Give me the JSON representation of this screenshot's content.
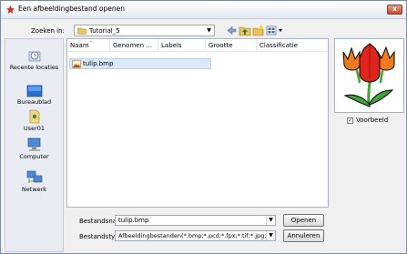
{
  "window": {
    "title": "Een afbeeldingbestand openen",
    "close_glyph": "x"
  },
  "toolbar": {
    "lookin_label": "Zoeken in:",
    "lookin_value": "Tutorial_5",
    "icons": [
      "back-icon",
      "up-folder-icon",
      "new-folder-icon",
      "view-menu-icon"
    ]
  },
  "places": [
    {
      "label": "Recente locaties",
      "icon": "recent-places-icon"
    },
    {
      "label": "Bureaublad",
      "icon": "desktop-icon"
    },
    {
      "label": "User01",
      "icon": "user-folder-icon"
    },
    {
      "label": "Computer",
      "icon": "computer-icon"
    },
    {
      "label": "Netwerk",
      "icon": "network-icon"
    }
  ],
  "filelist": {
    "columns": [
      "Naam",
      "Genomen ...",
      "Labels",
      "Grootte",
      "Classificatie"
    ],
    "files": [
      {
        "name": "tulip.bmp",
        "selected": true
      }
    ]
  },
  "preview": {
    "checkbox_label": "Voorbeeld",
    "checked": true,
    "check_glyph": "✓"
  },
  "form": {
    "filename_label": "Bestandsnaam:",
    "filename_value": "tulip.bmp",
    "filetype_label": "Bestandstypen:",
    "filetype_value": "Afbeeldingbestanden(*.bmp;*.pcd;*.fpx;*.tif;*.jpg;*.pcx",
    "open_label": "Openen",
    "cancel_label": "Annuleren",
    "dropdown_glyph": "▼"
  },
  "colors": {
    "selection": "#dce9f8",
    "tulip_red": "#e0241c",
    "tulip_orange": "#f07a1e",
    "leaf_green": "#3fa535"
  }
}
